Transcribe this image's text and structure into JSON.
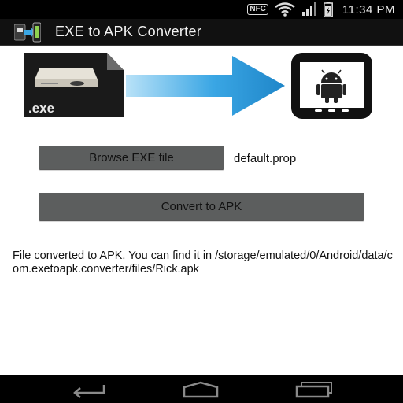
{
  "status_bar": {
    "nfc_label": "NFC",
    "time": "11:34 PM",
    "icons": [
      "nfc-icon",
      "wifi-icon",
      "signal-icon",
      "battery-icon"
    ]
  },
  "action_bar": {
    "title": "EXE to APK Converter",
    "icon": "app-icon"
  },
  "banner": {
    "exe_label": ".exe",
    "icons": [
      "exe-file-icon",
      "arrow-right-icon",
      "android-phone-icon"
    ],
    "colors": {
      "arrow": "#3aa6e4",
      "phone": "#111111",
      "android": "#222222"
    }
  },
  "browse": {
    "label": "Browse EXE file",
    "selected_file": "default.prop"
  },
  "convert": {
    "label": "Convert to APK"
  },
  "result": {
    "message": "File converted to APK. You can find it in /storage/emulated/0/Android/data/com.exetoapk.converter/files/Rick.apk"
  },
  "nav_bar": {
    "icons": [
      "back-icon",
      "home-icon",
      "recents-icon"
    ]
  },
  "colors": {
    "button_bg": "#5c5e5e",
    "content_bg": "#ffffff",
    "bar_bg": "#000000"
  }
}
